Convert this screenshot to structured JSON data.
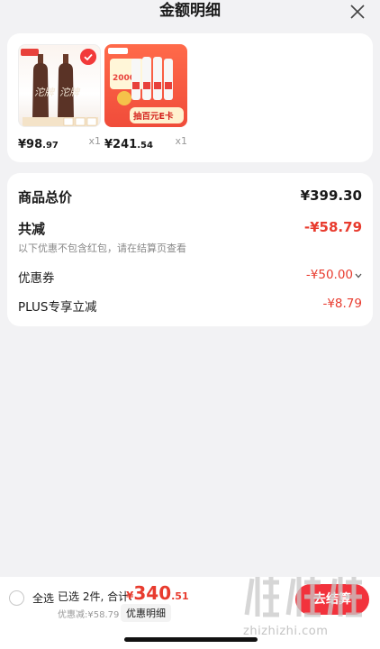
{
  "header": {
    "title": "金额明细",
    "close_icon": "close-icon"
  },
  "products": [
    {
      "price_int": "¥98",
      "price_dec": ".97",
      "qty": "x1",
      "image": "two dark liquor bottles with 沱牌 label",
      "selected": true
    },
    {
      "price_int": "¥241",
      "price_dec": ".54",
      "qty": "x1",
      "image": "red promo banner with white liquor bottles",
      "selected": true
    }
  ],
  "product_images": {
    "p1_label": "沱牌",
    "p2_badge": "2000",
    "p2_banner": "抽百元E卡"
  },
  "summary": {
    "total_label": "商品总价",
    "total_value": "¥399.30",
    "reduce_label": "共减",
    "reduce_value": "-¥58.79",
    "reduce_note": "以下优惠不包含红包，请在结算页查看",
    "coupon_label": "优惠券",
    "coupon_value": "-¥50.00",
    "plus_label": "PLUS专享立减",
    "plus_value": "-¥8.79"
  },
  "bottom": {
    "select_all": "全选",
    "selected_text": "已选 2件, 合计:",
    "total_yen": "¥",
    "total_int": "340",
    "total_dec": ".51",
    "discount_text": "优惠减:¥58.79",
    "detail_link": "优惠明细",
    "checkout": "去结算"
  },
  "watermark": {
    "text": "zhizhizhi.com"
  },
  "colors": {
    "accent": "#e83b2e",
    "button": "#f2323c",
    "background": "#f2f2f4"
  }
}
